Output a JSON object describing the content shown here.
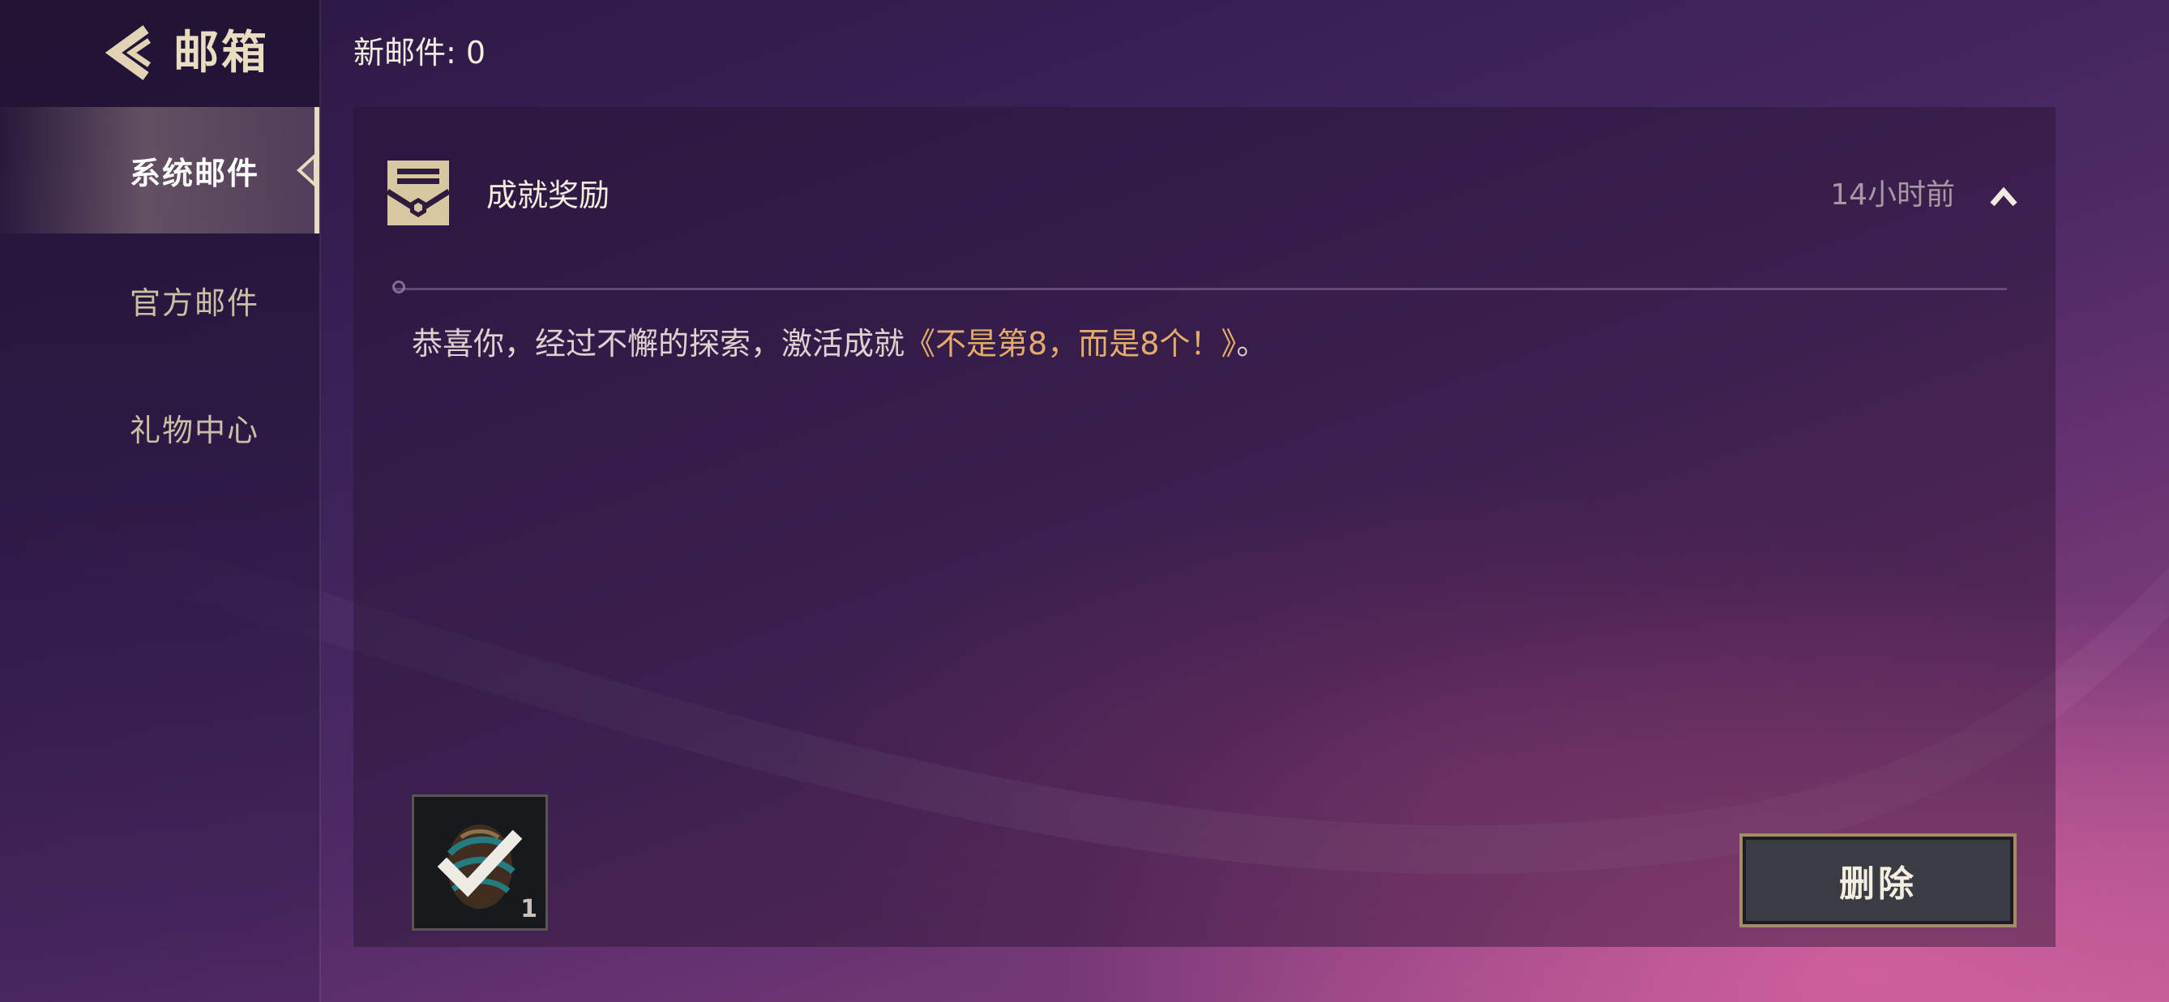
{
  "header": {
    "title": "邮箱",
    "new_mail_label": "新邮件: 0"
  },
  "sidebar": {
    "items": [
      {
        "label": "系统邮件",
        "active": true
      },
      {
        "label": "官方邮件",
        "active": false
      },
      {
        "label": "礼物中心",
        "active": false
      }
    ]
  },
  "mail": {
    "subject": "成就奖励",
    "time": "14小时前",
    "body_prefix": "恭喜你，经过不懈的探索，激活成就",
    "achievement_name": "《不是第8，而是8个！》",
    "body_suffix": "。",
    "attachment": {
      "count": "1",
      "claimed": true,
      "icon": "egg-icon"
    },
    "delete_label": "删除"
  },
  "colors": {
    "accent_gold": "#e8dcc0",
    "achievement_text": "#e4ac6a",
    "muted_time": "#a897a5"
  }
}
